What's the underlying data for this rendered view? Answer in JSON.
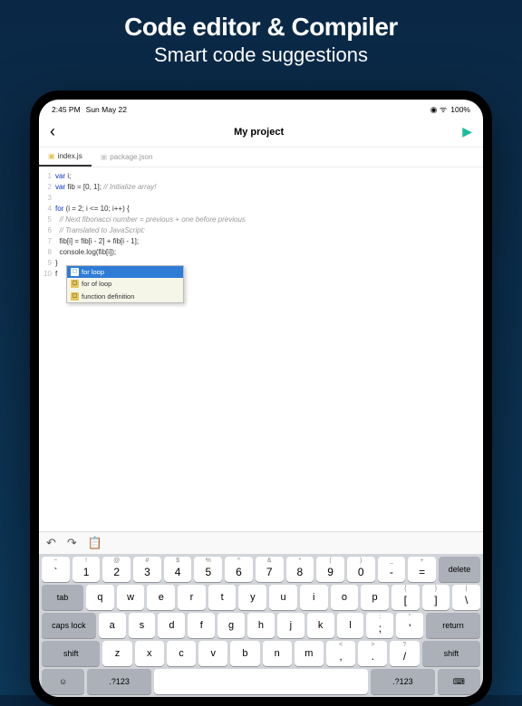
{
  "promo": {
    "title": "Code editor & Compiler",
    "subtitle": "Smart code suggestions"
  },
  "status": {
    "time": "2:45 PM",
    "date": "Sun May 22",
    "battery": "100%"
  },
  "nav": {
    "title": "My project"
  },
  "tabs": [
    {
      "label": "index.js",
      "active": true
    },
    {
      "label": "package.json",
      "active": false
    }
  ],
  "code": {
    "lines": [
      {
        "n": "1",
        "parts": [
          {
            "t": "var",
            "c": "kw"
          },
          {
            "t": " i;"
          }
        ]
      },
      {
        "n": "2",
        "parts": [
          {
            "t": "var",
            "c": "kw"
          },
          {
            "t": " fib = ["
          },
          {
            "t": "0",
            "c": "num"
          },
          {
            "t": ", "
          },
          {
            "t": "1",
            "c": "num"
          },
          {
            "t": "]; "
          },
          {
            "t": "// Initialize array!",
            "c": "cmt"
          }
        ]
      },
      {
        "n": "3",
        "parts": []
      },
      {
        "n": "4",
        "parts": [
          {
            "t": "for",
            "c": "kw"
          },
          {
            "t": " (i = "
          },
          {
            "t": "2",
            "c": "num"
          },
          {
            "t": "; i <= "
          },
          {
            "t": "10",
            "c": "num"
          },
          {
            "t": "; i++) {"
          }
        ]
      },
      {
        "n": "5",
        "parts": [
          {
            "t": "  "
          },
          {
            "t": "// Next fibonacci number = previous + one before previous",
            "c": "cmt"
          }
        ]
      },
      {
        "n": "6",
        "parts": [
          {
            "t": "  "
          },
          {
            "t": "// Translated to JavaScript:",
            "c": "cmt"
          }
        ]
      },
      {
        "n": "7",
        "parts": [
          {
            "t": "  fib[i] = fib[i - "
          },
          {
            "t": "2",
            "c": "num"
          },
          {
            "t": "] + fib[i - "
          },
          {
            "t": "1",
            "c": "num"
          },
          {
            "t": "];"
          }
        ]
      },
      {
        "n": "8",
        "parts": [
          {
            "t": "  console.log(fib[i]);"
          }
        ]
      },
      {
        "n": "9",
        "parts": [
          {
            "t": "}"
          }
        ]
      },
      {
        "n": "10",
        "parts": [
          {
            "t": "f"
          }
        ]
      }
    ]
  },
  "autocomplete": [
    {
      "label": "for loop",
      "selected": true
    },
    {
      "label": "for of loop",
      "selected": false
    },
    {
      "label": "function definition",
      "selected": false
    }
  ],
  "keyboard": {
    "row_nums": [
      {
        "sub": "~",
        "main": "`"
      },
      {
        "sub": "!",
        "main": "1"
      },
      {
        "sub": "@",
        "main": "2"
      },
      {
        "sub": "#",
        "main": "3"
      },
      {
        "sub": "$",
        "main": "4"
      },
      {
        "sub": "%",
        "main": "5"
      },
      {
        "sub": "^",
        "main": "6"
      },
      {
        "sub": "&",
        "main": "7"
      },
      {
        "sub": "*",
        "main": "8"
      },
      {
        "sub": "(",
        "main": "9"
      },
      {
        "sub": ")",
        "main": "0"
      },
      {
        "sub": "_",
        "main": "-"
      },
      {
        "sub": "+",
        "main": "="
      }
    ],
    "row_q": [
      "q",
      "w",
      "e",
      "r",
      "t",
      "y",
      "u",
      "i",
      "o",
      "p"
    ],
    "row_q_end": [
      {
        "sub": "{",
        "main": "["
      },
      {
        "sub": "}",
        "main": "]"
      },
      {
        "sub": "|",
        "main": "\\"
      }
    ],
    "row_a": [
      "a",
      "s",
      "d",
      "f",
      "g",
      "h",
      "j",
      "k",
      "l"
    ],
    "row_a_end": [
      {
        "sub": ":",
        "main": ";"
      },
      {
        "sub": "\"",
        "main": "'"
      }
    ],
    "row_z": [
      "z",
      "x",
      "c",
      "v",
      "b",
      "n",
      "m"
    ],
    "row_z_end": [
      {
        "sub": "<",
        "main": ","
      },
      {
        "sub": ">",
        "main": "."
      },
      {
        "sub": "?",
        "main": "/"
      }
    ],
    "special": {
      "delete": "delete",
      "tab": "tab",
      "caps": "caps lock",
      "return": "return",
      "shift": "shift",
      "sym": ".?123"
    }
  }
}
